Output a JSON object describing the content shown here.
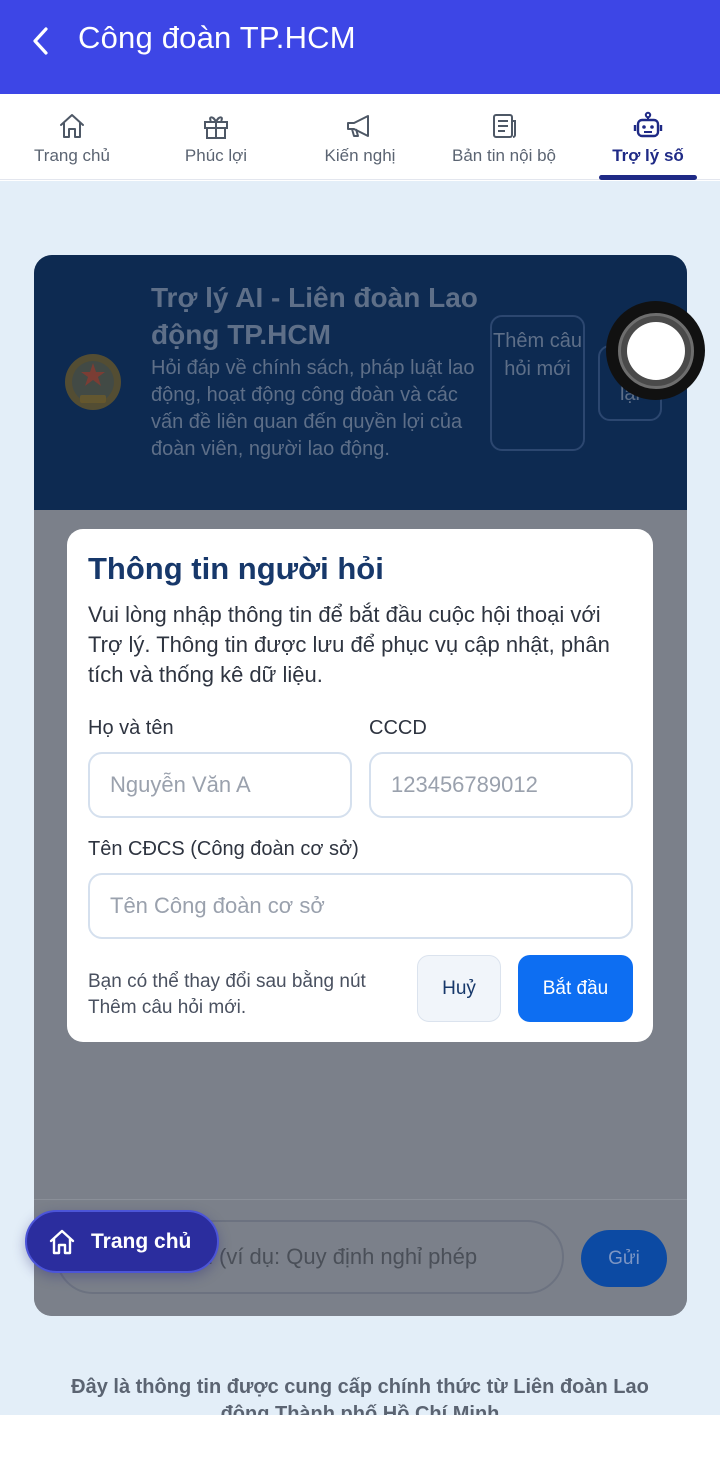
{
  "header": {
    "title": "Công đoàn TP.HCM",
    "back_icon": "chevron-left-icon"
  },
  "tabs": [
    {
      "label": "Trang chủ",
      "icon": "home-icon",
      "active": false
    },
    {
      "label": "Phúc lợi",
      "icon": "gift-icon",
      "active": false
    },
    {
      "label": "Kiến nghị",
      "icon": "megaphone-icon",
      "active": false
    },
    {
      "label": "Bản tin nội bộ",
      "icon": "newspaper-icon",
      "active": false
    },
    {
      "label": "Trợ lý số",
      "icon": "robot-icon",
      "active": true
    }
  ],
  "assistant": {
    "title": "Trợ lý AI - Liên đoàn Lao động TP.HCM",
    "description": "Hỏi đáp về chính sách, pháp luật lao động, hoạt động công đoàn và các vấn đề liên quan đến quyền lợi của đoàn viên, người lao động.",
    "new_question_label": "Thêm câu hỏi mới",
    "reset_label": "lại",
    "input_placeholder": "i (ví dụ: Quy định nghỉ phép",
    "send_label": "Gửi"
  },
  "modal": {
    "title": "Thông tin người hỏi",
    "description": "Vui lòng nhập thông tin để bắt đầu cuộc hội thoại với Trợ lý. Thông tin được lưu để phục vụ cập nhật, phân tích và thống kê dữ liệu.",
    "name_label": "Họ và tên",
    "name_placeholder": "Nguyễn Văn A",
    "id_label": "CCCD",
    "id_placeholder": "123456789012",
    "union_label": "Tên CĐCS (Công đoàn cơ sở)",
    "union_placeholder": "Tên Công đoàn cơ sở",
    "note": "Bạn có thể thay đổi sau bằng nút Thêm câu hỏi mới.",
    "cancel_label": "Huỷ",
    "start_label": "Bắt đầu"
  },
  "home_pill": {
    "label": "Trang chủ"
  },
  "disclaimer": "Đây là thông tin được cung cấp chính thức từ Liên đoàn Lao động Thành phố Hồ Chí Minh",
  "colors": {
    "header": "#3d46e6",
    "active_tab": "#1f2a86",
    "primary": "#0d6ef2",
    "overlay": "#7b808a"
  }
}
